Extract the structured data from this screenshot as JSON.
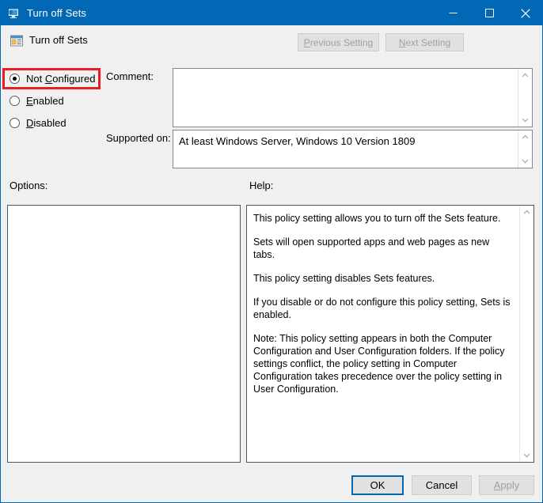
{
  "window": {
    "title": "Turn off Sets",
    "title_icon": "computer-monitor-icon",
    "minimize_label": "Minimize",
    "maximize_label": "Maximize",
    "close_label": "Close",
    "accent_color": "#0068b5",
    "background_color": "#f0f0f0"
  },
  "header": {
    "policy_icon": "policy-setting-icon",
    "policy_title": "Turn off Sets",
    "previous_setting": "Previous Setting",
    "previous_accel": "P",
    "next_setting": "Next Setting",
    "next_accel": "N"
  },
  "state_options": {
    "selected": "Not Configured",
    "highlight_color": "#ec1c24",
    "items": [
      {
        "label": "Not Configured",
        "accel_before": "Not ",
        "accel": "C",
        "accel_after": "onfigured",
        "checked": true
      },
      {
        "label": "Enabled",
        "accel_before": "",
        "accel": "E",
        "accel_after": "nabled",
        "checked": false
      },
      {
        "label": "Disabled",
        "accel_before": "",
        "accel": "D",
        "accel_after": "isabled",
        "checked": false
      }
    ]
  },
  "comment": {
    "label": "Comment:",
    "value": "",
    "scroll_up_icon": "chevron-up-icon",
    "scroll_down_icon": "chevron-down-icon"
  },
  "supported_on": {
    "label": "Supported on:",
    "value": "At least Windows Server, Windows 10 Version 1809",
    "scroll_up_icon": "chevron-up-icon",
    "scroll_down_icon": "chevron-down-icon"
  },
  "options": {
    "label": "Options:",
    "content": ""
  },
  "help": {
    "label": "Help:",
    "scroll_up_icon": "chevron-up-icon",
    "scroll_down_icon": "chevron-down-icon",
    "paragraphs": [
      "This policy setting allows you to turn off the Sets feature.",
      "Sets will open supported apps and web pages as new tabs.",
      "This policy setting disables Sets features.",
      "If you disable or do not configure this policy setting, Sets is enabled.",
      "Note: This policy setting appears in both the Computer Configuration and User Configuration folders. If the policy settings conflict, the policy setting in Computer Configuration takes precedence over the policy setting in User Configuration."
    ]
  },
  "footer": {
    "ok": "OK",
    "cancel": "Cancel",
    "apply": "Apply",
    "apply_accel": "A",
    "apply_enabled": false
  }
}
